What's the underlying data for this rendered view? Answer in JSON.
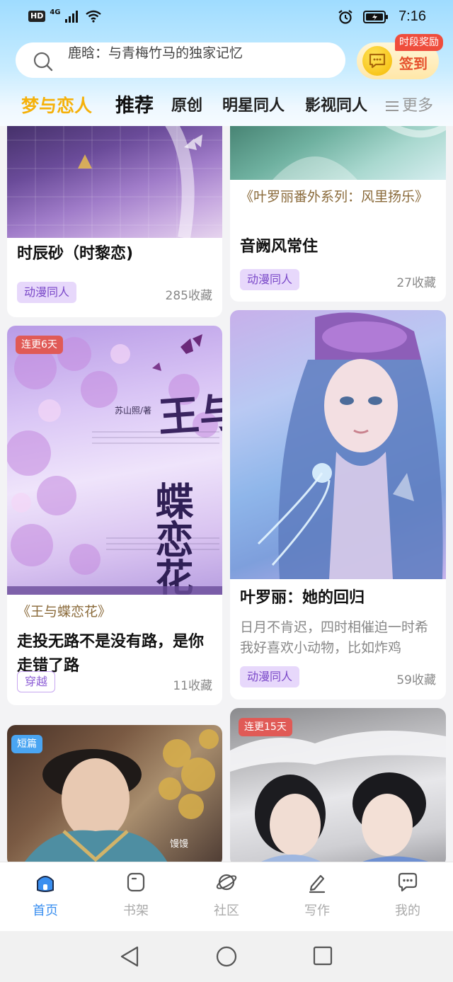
{
  "status_bar": {
    "hd": "HD",
    "net": "4G",
    "time": "7:16"
  },
  "search": {
    "text": "鹿晗：与青梅竹马的独家记忆"
  },
  "checkin": {
    "label": "签到",
    "reward_tag": "时段奖励"
  },
  "tabs": {
    "brand": "梦与恋人",
    "items": [
      "推荐",
      "原创",
      "明星同人",
      "影视同人"
    ],
    "more": "更多"
  },
  "cards": [
    {
      "title": "时辰砂（时黎恋)",
      "tag": "动漫同人",
      "favorites": "285收藏"
    },
    {
      "subtitle": "《叶罗丽番外系列：风里扬乐》",
      "title": "音阙风常住",
      "tag": "动漫同人",
      "favorites": "27收藏"
    },
    {
      "badge": "连更6天",
      "cover_author": "苏山照/著",
      "cover_title_1": "王与",
      "cover_title_2": "蝶恋花",
      "subtitle": "《王与蝶恋花》",
      "title": "走投无路不是没有路，是你走错了路",
      "tag": "穿越",
      "favorites": "11收藏"
    },
    {
      "title": "叶罗丽：她的回归",
      "description": "日月不肯迟，四时相催迫一时希我好喜欢小动物，比如炸鸡",
      "tag": "动漫同人",
      "favorites": "59收藏"
    },
    {
      "badge": "短篇",
      "cover_caption": "馒馒"
    },
    {
      "badge": "连更15天"
    }
  ],
  "bottom_nav": [
    {
      "label": "首页",
      "icon": "home-icon"
    },
    {
      "label": "书架",
      "icon": "bookshelf-icon"
    },
    {
      "label": "社区",
      "icon": "planet-icon"
    },
    {
      "label": "写作",
      "icon": "pen-icon"
    },
    {
      "label": "我的",
      "icon": "chat-bubble-icon"
    }
  ],
  "colors": {
    "accent": "#3a8ff0",
    "brand": "#f5b10a",
    "tag_bg": "#e7d8fb",
    "tag_text": "#7a48c8"
  }
}
